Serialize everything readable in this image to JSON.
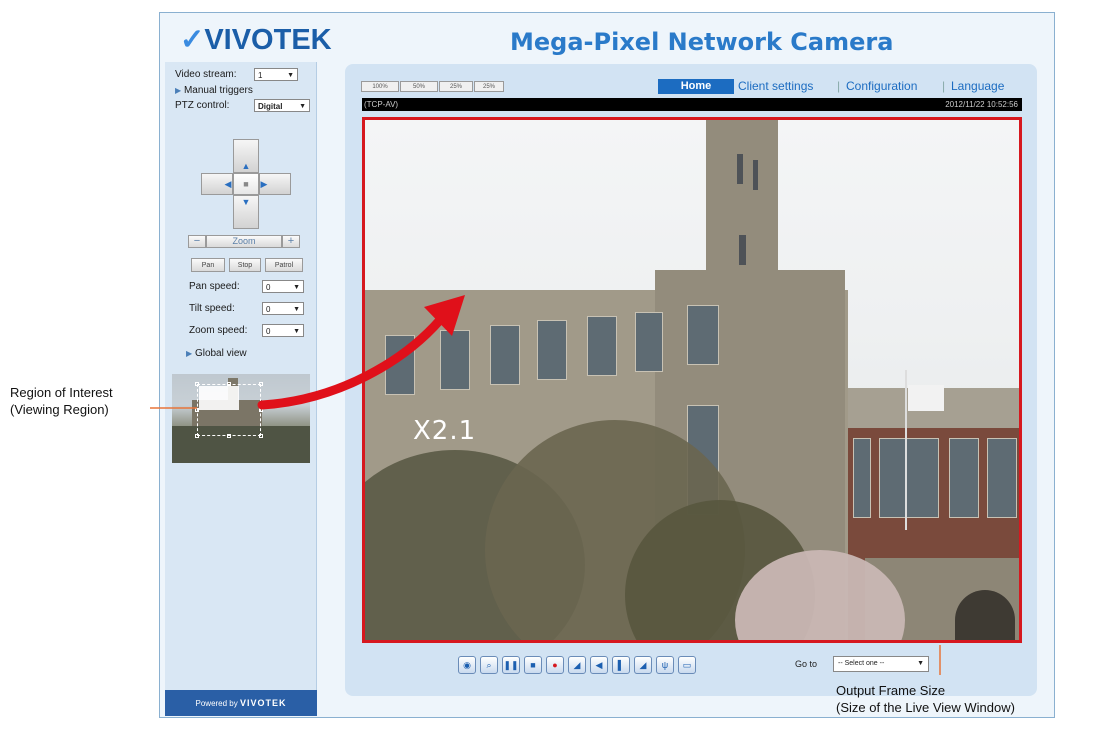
{
  "header": {
    "logo_text": "VIVOTEK",
    "logo_tagline": "",
    "title": "Mega-Pixel Network Camera"
  },
  "sidebar": {
    "video_stream_label": "Video stream:",
    "video_stream_value": "1",
    "manual_triggers_label": "Manual triggers",
    "ptz_control_label": "PTZ control:",
    "ptz_control_value": "Digital",
    "zoom_label": "Zoom",
    "zoom_minus": "−",
    "zoom_plus": "+",
    "preset_buttons": [
      "Pan",
      "Stop",
      "Patrol"
    ],
    "pan_speed_label": "Pan speed:",
    "pan_speed_value": "0",
    "tilt_speed_label": "Tilt speed:",
    "tilt_speed_value": "0",
    "zoom_speed_label": "Zoom speed:",
    "zoom_speed_value": "0",
    "global_view_label": "Global view",
    "powered_by_label": "Powered by",
    "powered_by_brand": "VIVOTEK"
  },
  "size_buttons": [
    "100%",
    "50%",
    "25%",
    "25%"
  ],
  "nav": {
    "home": "Home",
    "client_settings": "Client settings",
    "configuration": "Configuration",
    "language": "Language"
  },
  "video": {
    "protocol": "(TCP-AV)",
    "timestamp": "2012/11/22 10:52:56",
    "zoom_overlay": "X2.1"
  },
  "toolbar": {
    "icons": [
      "camera-icon",
      "zoom-icon",
      "pause-icon",
      "stop-icon",
      "record-icon",
      "volume-icon",
      "speaker-icon",
      "talk-icon",
      "upload-icon",
      "mic-icon",
      "fullscreen-icon"
    ],
    "goto_label": "Go to",
    "goto_value": "-- Select one --"
  },
  "annotations": {
    "roi_line1": "Region of Interest",
    "roi_line2": "(Viewing Region)",
    "output_line1": "Output Frame Size",
    "output_line2": "(Size of the Live View Window)"
  },
  "colors": {
    "brand_blue": "#1c6cc1",
    "title_blue": "#2a7ac9",
    "video_border": "#d6181f",
    "arrow_red": "#e0101a",
    "leader_orange": "#e8753a"
  }
}
